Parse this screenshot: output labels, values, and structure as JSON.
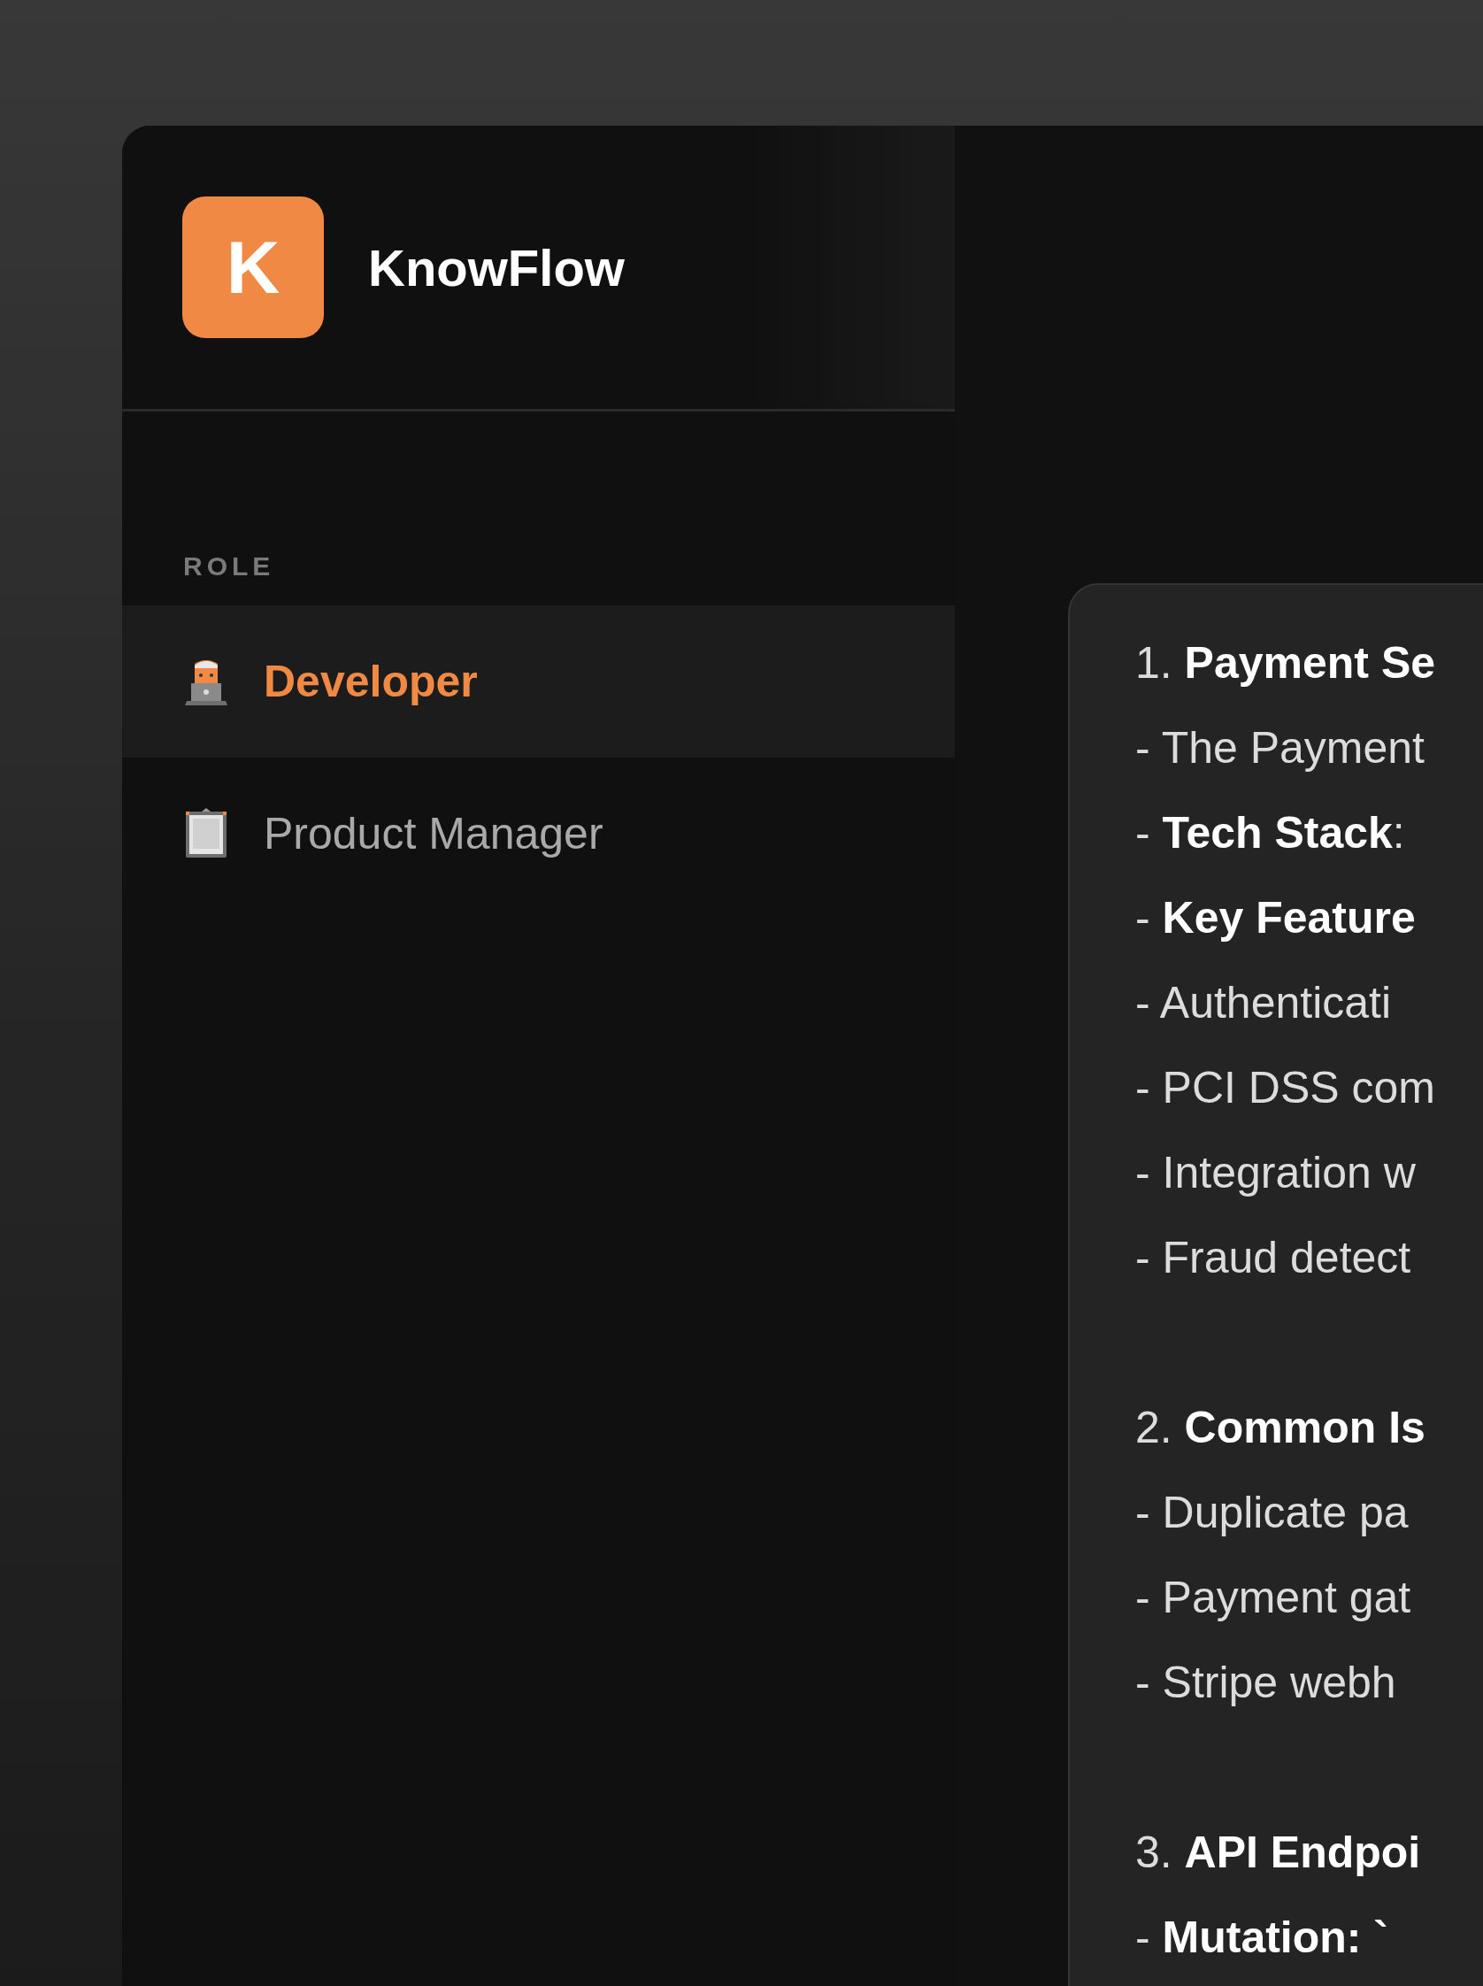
{
  "app": {
    "logo_letter": "K",
    "name": "KnowFlow"
  },
  "sidebar": {
    "section_label": "ROLE",
    "roles": [
      {
        "label": "Developer",
        "kind": "developer",
        "selected": true
      },
      {
        "label": "Product Manager",
        "kind": "clipboard",
        "selected": false
      }
    ]
  },
  "answer": {
    "sections": [
      {
        "lines": [
          "1. **Payment Se**",
          "- The Payment",
          "- **Tech Stack**:",
          "- **Key Feature**",
          "- Authenticati",
          "- PCI DSS com",
          "- Integration w",
          "- Fraud detect"
        ]
      },
      {
        "lines": [
          "2. **Common Is**",
          "- Duplicate pa",
          "- Payment gat",
          "- Stripe webh"
        ]
      },
      {
        "lines": [
          "3. **API Endpoi**",
          "- **Mutation: `**"
        ]
      }
    ]
  }
}
